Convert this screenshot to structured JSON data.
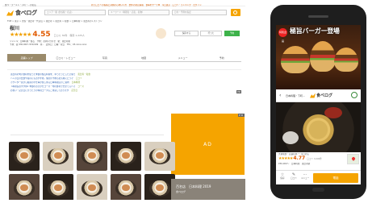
{
  "desktop": {
    "topbar": {
      "left": "食べ・ラーメン・下町・…の名店",
      "right": "新っ口コミの投稿と評価の心地いい方　野外の新店情報　食事をサーチ▼　今日選ぶ　口コミ・ランキング　ログイン"
    },
    "logo": {
      "text": "食べログ"
    },
    "search": {
      "area_placeholder": "エリア・駅 (渋谷駅・名店)",
      "keyword_placeholder": "キーワード（料理名・店名、名物）",
      "date_placeholder": "日付・予算を指定"
    },
    "breadcrumb": "TOP > 東京 > 渋谷・恵比寿・代官山 > 恵比寿 > 恵比寿 > 和食 > 日本料理 > 恵比寿のレストラン",
    "restaurant": {
      "name": "桜川",
      "stars": "★★★★★",
      "score": "4.55",
      "counts": "口コミ 30件　保存 1,225人",
      "info": [
        "ジャンル：日本料理・懐石　予約：お問い合わせ　駅：恵比寿駅",
        "予算：夜 ¥30,000〜¥39,999　昼 -　定休日：日曜・祝日　TEL：03-xxxx-xxxx"
      ]
    },
    "actions": [
      "保存する",
      "行った",
      "予約"
    ],
    "tabs": [
      "店舗トップ",
      "口コミ・レビュー",
      "写真",
      "地図",
      "メニュー",
      "予約"
    ],
    "active_tab": "店舗トップ",
    "news": [
      {
        "text": "恵比寿の旬の食材を使った季節の懐石料理を、ゆったりとした空間で",
        "tag": "恵比寿・和食"
      },
      {
        "text": "ハレの日の会食や接待にもおすすめ。個室の予約もお気軽にどうぞ",
        "tag": "口コミ"
      },
      {
        "text": "カウンター席から板前の手仕事が楽しめる日本料理店のご案内",
        "tag": "日本料理"
      },
      {
        "text": "【料理長おすすめ】季節のおまかせコース・旬の食材で仕立てる八寸",
        "tag": "コース"
      },
      {
        "text": "お祝い・記念日にぴったりの特別コースもご用意しております",
        "tag": "記念日"
      }
    ],
    "side_label": "PR",
    "ad": {
      "label": "AD",
      "pr": "PR"
    },
    "footer": {
      "title": "百名店　日本料理 2019",
      "sub": "食べログ"
    }
  },
  "phone": {
    "banner": {
      "badge": "特別企画",
      "title": "極旨バーガー登場"
    },
    "nav": {
      "back": "‹",
      "name": "日本料理・下町...",
      "logo": "食べログ"
    },
    "restaurant": {
      "name": "大衆和食・店舗名称 ー 今日の店",
      "stars": "★★★★★",
      "score": "4.77",
      "counts": "口コミ 3,000件",
      "meta": "¥30,000〜　日本料理　恵比寿駅"
    },
    "actions": [
      {
        "glyph": "☆",
        "label": "保存"
      },
      {
        "glyph": "✎",
        "label": "口コミ"
      },
      {
        "glyph": "⋯",
        "label": "メニュー"
      }
    ],
    "call": "電話"
  },
  "colors": {
    "brand": "#f5a400",
    "score": "#e05a00",
    "link": "#2a5fb0",
    "tab_active": "#9a8a6a"
  }
}
